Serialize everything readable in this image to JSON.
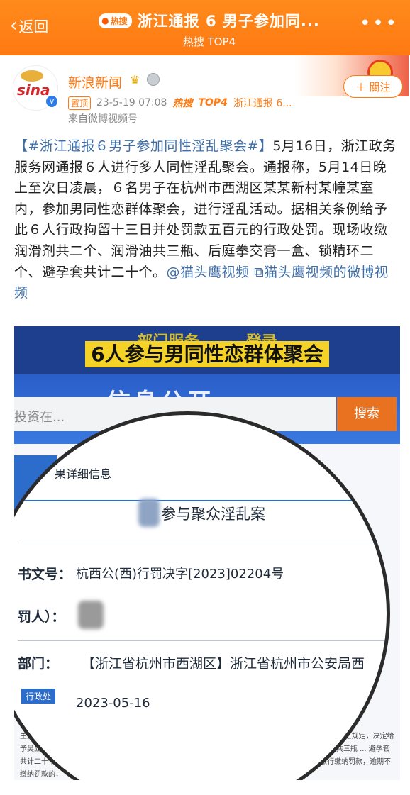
{
  "header": {
    "back_label": "返回",
    "hot_badge": "热搜",
    "title": "浙江通报 6 男子参加同...",
    "subtitle": "热搜 TOP4",
    "more_icon": "ellipsis-icon",
    "colors": {
      "bg": "#ff7a12",
      "text": "#ffffff"
    }
  },
  "account": {
    "name": "新浪新闻",
    "pin_tag": "置顶",
    "timestamp": "23-5-19 07:08",
    "hot_tag": "热搜",
    "top_tag": "TOP4",
    "topic_tag": "浙江通报 6...",
    "source": "来自微博视频号",
    "follow_label": "關注"
  },
  "post": {
    "topic": "【#浙江通报６男子参加同性淫乱聚会#】",
    "body": "5月16日，浙江政务服务网通报６人进行多人同性淫乱聚会。通报称，5月14日晚上至次日凌晨，６名男子在杭州市西湖区某某新村某幢某室内，参加男同性恋群体聚会，进行淫乱活动。据相关条例给予此６人行政拘留十三日并处罚款五百元的行政处罚。现场收缴润滑剂共二个、润滑油共三瓶、后庭拳交膏一盒、锁精环二个、避孕套共计二十个。",
    "mention_link": "@猫头鹰视频",
    "video_link": "猫头鹰视频的微博视频"
  },
  "image": {
    "caption_top": "部门服务 ...... 登录",
    "caption_main": "6人参与男同性恋群体聚会",
    "band_title": "信息公开",
    "search_placeholder": "投资在...",
    "search_button": "搜索",
    "detail_heading": "果详细信息",
    "case_title": "参与聚众淫乱案",
    "doc_no_label": "书文号：",
    "doc_no_value": "杭西公(西)行罚决字[2023]02204号",
    "person_label": "罚人）：",
    "dept_label": "部门：",
    "dept_value": "【浙江省杭州市西湖区】浙江省杭州市公安局西",
    "date_value": "2023-05-16",
    "side_label": "行政处",
    "doc_fine_text": "主要违法事实 ... 召集他人组织、参集的男同性恋群体 ... 行政处罚的种类和依据：根 ... 第十七条第一款之规定，决定给予吴立刚行政拘留十三日 ... 治安管理处罚法》第十一条第一款之规定，并收缴润滑剂共二个、润滑油共三瓶 ... 避孕套共计二十个。 行政处罚的执行方式和期限：自收到本决定书之日起十五日内，凭本决定书到建设银行缴纳罚款，逾期不缴纳罚款的，"
  }
}
